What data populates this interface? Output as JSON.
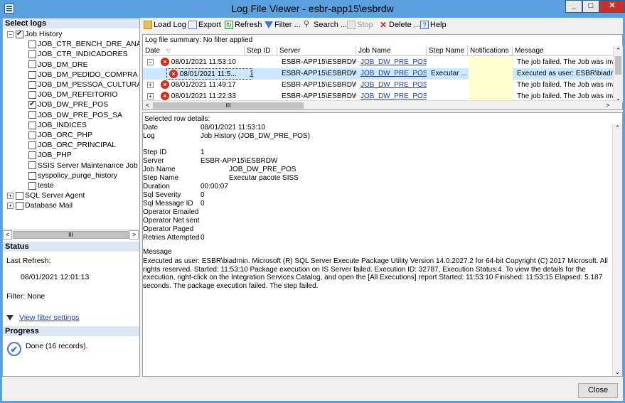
{
  "window": {
    "title": "Log File Viewer - esbr-app15\\esbrdw",
    "min": "_",
    "max": "□",
    "close": "✕"
  },
  "left": {
    "select_logs_title": "Select logs",
    "tree": [
      {
        "label": "Job History",
        "level": 0,
        "expander": "−",
        "checked": true
      },
      {
        "label": "JOB_CTR_BENCH_DRE_ANALISE",
        "level": 1,
        "checked": false
      },
      {
        "label": "JOB_CTR_INDICADORES",
        "level": 1,
        "checked": false
      },
      {
        "label": "JOB_DM_DRE",
        "level": 1,
        "checked": false
      },
      {
        "label": "JOB_DM_PEDIDO_COMPRA",
        "level": 1,
        "checked": false
      },
      {
        "label": "JOB_DM_PESSOA_CULTURA",
        "level": 1,
        "checked": false
      },
      {
        "label": "JOB_DM_REFEITORIO",
        "level": 1,
        "checked": false
      },
      {
        "label": "JOB_DW_PRE_POS",
        "level": 1,
        "checked": true
      },
      {
        "label": "JOB_DW_PRE_POS_SA",
        "level": 1,
        "checked": false
      },
      {
        "label": "JOB_INDICES",
        "level": 1,
        "checked": false
      },
      {
        "label": "JOB_ORC_PHP",
        "level": 1,
        "checked": false
      },
      {
        "label": "JOB_ORC_PRINCIPAL",
        "level": 1,
        "checked": false
      },
      {
        "label": "JOB_PHP",
        "level": 1,
        "checked": false
      },
      {
        "label": "SSIS Server Maintenance Job",
        "level": 1,
        "checked": false
      },
      {
        "label": "syspolicy_purge_history",
        "level": 1,
        "checked": false
      },
      {
        "label": "teste",
        "level": 1,
        "checked": false
      },
      {
        "label": "SQL Server Agent",
        "level": 0,
        "expander": "+",
        "checked": false
      },
      {
        "label": "Database Mail",
        "level": 0,
        "expander": "+",
        "checked": false
      }
    ],
    "scroll_left": "<",
    "scroll_right": ">",
    "scroll_thumb": "III",
    "status_title": "Status",
    "last_refresh_label": "Last Refresh:",
    "last_refresh_value": "08/01/2021 12:01:13",
    "filter_label": "Filter: None",
    "view_filter_link": "View filter settings",
    "progress_title": "Progress",
    "progress_text": "Done (16 records)."
  },
  "toolbar": {
    "load_log": "Load Log",
    "export": "Export",
    "refresh": "Refresh",
    "filter": "Filter ...",
    "search": "Search ...",
    "stop": "Stop",
    "delete": "Delete ...",
    "help": "Help"
  },
  "grid": {
    "summary": "Log file summary: No filter applied",
    "columns": [
      "Date",
      "Step ID",
      "Server",
      "Job Name",
      "Step Name",
      "Notifications",
      "Message"
    ],
    "sort_glyph": "▽",
    "rows": [
      {
        "expander": "−",
        "date": "08/01/2021 11:53:10",
        "step_id": "",
        "server": "ESBR-APP15\\ESBRDW",
        "job": "JOB_DW_PRE_POS",
        "step": "",
        "notif": "",
        "message": "The job failed.  The Job was invok"
      },
      {
        "expander": "",
        "date": "08/01/2021 11:5...",
        "step_id": "1",
        "server": "ESBR-APP15\\ESBRDW",
        "job": "JOB_DW_PRE_POS",
        "step": "Executar ...",
        "notif": "",
        "message": "Executed as user: ESBR\\biadmin."
      },
      {
        "expander": "+",
        "date": "08/01/2021 11:49:17",
        "step_id": "",
        "server": "ESBR-APP15\\ESBRDW",
        "job": "JOB_DW_PRE_POS",
        "step": "",
        "notif": "",
        "message": "The job failed.  The Job was invok"
      },
      {
        "expander": "+",
        "date": "08/01/2021 11:22:33",
        "step_id": "",
        "server": "ESBR-APP15\\ESBRDW",
        "job": "JOB_DW_PRE_POS",
        "step": "",
        "notif": "",
        "message": "The job failed.  The Job was invok"
      }
    ],
    "hscroll_thumb": "III"
  },
  "details": {
    "header": "Selected row details:",
    "fields": [
      {
        "label": "Date",
        "value": "08/01/2021 11:53:10"
      },
      {
        "label": "Log",
        "value": "Job History (JOB_DW_PRE_POS)"
      },
      {
        "label": "Step ID",
        "value": "1"
      },
      {
        "label": "Server",
        "value": "ESBR-APP15\\ESBRDW"
      },
      {
        "label": "Job Name",
        "value": "JOB_DW_PRE_POS"
      },
      {
        "label": "Step Name",
        "value": "Executar pacote SISS"
      },
      {
        "label": "Duration",
        "value": "00:00:07"
      },
      {
        "label": "Sql Severity",
        "value": "0"
      },
      {
        "label": "Sql Message ID",
        "value": "0"
      },
      {
        "label": "Operator Emailed",
        "value": ""
      },
      {
        "label": "Operator Net sent",
        "value": ""
      },
      {
        "label": "Operator Paged",
        "value": ""
      },
      {
        "label": "Retries Attempted",
        "value": "0"
      }
    ],
    "message_label": "Message",
    "message_text": "Executed as user: ESBR\\biadmin. Microsoft (R) SQL Server Execute Package Utility  Version 14.0.2027.2 for 64-bit  Copyright (C) 2017 Microsoft. All rights reserved.    Started:  11:53:10  Package execution on IS Server failed. Execution ID: 32787, Execution Status:4.  To view the details for the execution, right-click on the Integration Services Catalog, and open the [All Executions] report  Started:  11:53:10  Finished: 11:53:15  Elapsed:  5.187 seconds.  The package execution failed.  The step failed."
  },
  "close_button": "Close"
}
